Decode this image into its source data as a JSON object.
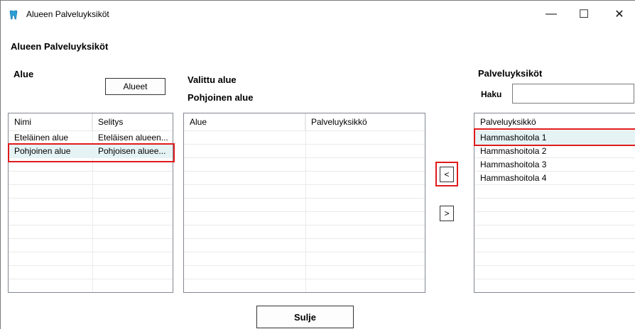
{
  "window": {
    "title": "Alueen Palveluyksiköt",
    "minimize": "—",
    "maximize": "☐",
    "close": "✕"
  },
  "header": {
    "title": "Alueen Palveluyksiköt"
  },
  "left": {
    "label": "Alue",
    "button": "Alueet",
    "columns": [
      "Nimi",
      "Selitys"
    ],
    "rows": [
      {
        "nimi": "Eteläinen alue",
        "selitys": "Eteläisen alueen..."
      },
      {
        "nimi": "Pohjoinen alue",
        "selitys": "Pohjoisen aluee..."
      }
    ],
    "selected_index": 1
  },
  "middle": {
    "label": "Valittu alue",
    "value": "Pohjoinen alue",
    "columns": [
      "Alue",
      "Palveluyksikkö"
    ]
  },
  "arrows": {
    "left": "<",
    "right": ">"
  },
  "right": {
    "label": "Palveluyksiköt",
    "search_label": "Haku",
    "search_value": "",
    "column": "Palveluyksikkö",
    "rows": [
      "Hammashoitola 1",
      "Hammashoitola 2",
      "Hammashoitola 3",
      "Hammashoitola 4"
    ],
    "selected_index": 0
  },
  "footer": {
    "close_button": "Sulje"
  },
  "colors": {
    "selection": "#e5f3f4",
    "highlight": "#e01b1b"
  },
  "icons": {
    "app": "tooth-icon"
  }
}
